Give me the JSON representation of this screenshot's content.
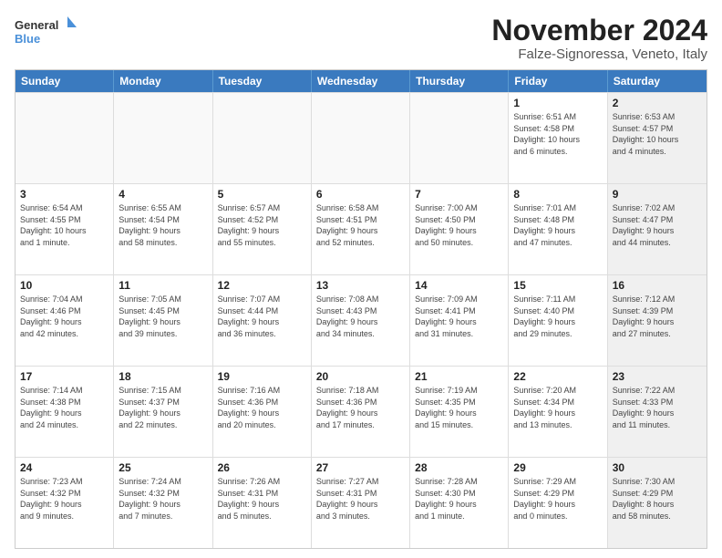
{
  "logo": {
    "line1": "General",
    "line2": "Blue"
  },
  "title": "November 2024",
  "subtitle": "Falze-Signoressa, Veneto, Italy",
  "header_days": [
    "Sunday",
    "Monday",
    "Tuesday",
    "Wednesday",
    "Thursday",
    "Friday",
    "Saturday"
  ],
  "weeks": [
    [
      {
        "day": "",
        "info": "",
        "shaded": true
      },
      {
        "day": "",
        "info": "",
        "shaded": true
      },
      {
        "day": "",
        "info": "",
        "shaded": true
      },
      {
        "day": "",
        "info": "",
        "shaded": true
      },
      {
        "day": "",
        "info": "",
        "shaded": true
      },
      {
        "day": "1",
        "info": "Sunrise: 6:51 AM\nSunset: 4:58 PM\nDaylight: 10 hours\nand 6 minutes.",
        "shaded": false
      },
      {
        "day": "2",
        "info": "Sunrise: 6:53 AM\nSunset: 4:57 PM\nDaylight: 10 hours\nand 4 minutes.",
        "shaded": true
      }
    ],
    [
      {
        "day": "3",
        "info": "Sunrise: 6:54 AM\nSunset: 4:55 PM\nDaylight: 10 hours\nand 1 minute.",
        "shaded": false
      },
      {
        "day": "4",
        "info": "Sunrise: 6:55 AM\nSunset: 4:54 PM\nDaylight: 9 hours\nand 58 minutes.",
        "shaded": false
      },
      {
        "day": "5",
        "info": "Sunrise: 6:57 AM\nSunset: 4:52 PM\nDaylight: 9 hours\nand 55 minutes.",
        "shaded": false
      },
      {
        "day": "6",
        "info": "Sunrise: 6:58 AM\nSunset: 4:51 PM\nDaylight: 9 hours\nand 52 minutes.",
        "shaded": false
      },
      {
        "day": "7",
        "info": "Sunrise: 7:00 AM\nSunset: 4:50 PM\nDaylight: 9 hours\nand 50 minutes.",
        "shaded": false
      },
      {
        "day": "8",
        "info": "Sunrise: 7:01 AM\nSunset: 4:48 PM\nDaylight: 9 hours\nand 47 minutes.",
        "shaded": false
      },
      {
        "day": "9",
        "info": "Sunrise: 7:02 AM\nSunset: 4:47 PM\nDaylight: 9 hours\nand 44 minutes.",
        "shaded": true
      }
    ],
    [
      {
        "day": "10",
        "info": "Sunrise: 7:04 AM\nSunset: 4:46 PM\nDaylight: 9 hours\nand 42 minutes.",
        "shaded": false
      },
      {
        "day": "11",
        "info": "Sunrise: 7:05 AM\nSunset: 4:45 PM\nDaylight: 9 hours\nand 39 minutes.",
        "shaded": false
      },
      {
        "day": "12",
        "info": "Sunrise: 7:07 AM\nSunset: 4:44 PM\nDaylight: 9 hours\nand 36 minutes.",
        "shaded": false
      },
      {
        "day": "13",
        "info": "Sunrise: 7:08 AM\nSunset: 4:43 PM\nDaylight: 9 hours\nand 34 minutes.",
        "shaded": false
      },
      {
        "day": "14",
        "info": "Sunrise: 7:09 AM\nSunset: 4:41 PM\nDaylight: 9 hours\nand 31 minutes.",
        "shaded": false
      },
      {
        "day": "15",
        "info": "Sunrise: 7:11 AM\nSunset: 4:40 PM\nDaylight: 9 hours\nand 29 minutes.",
        "shaded": false
      },
      {
        "day": "16",
        "info": "Sunrise: 7:12 AM\nSunset: 4:39 PM\nDaylight: 9 hours\nand 27 minutes.",
        "shaded": true
      }
    ],
    [
      {
        "day": "17",
        "info": "Sunrise: 7:14 AM\nSunset: 4:38 PM\nDaylight: 9 hours\nand 24 minutes.",
        "shaded": false
      },
      {
        "day": "18",
        "info": "Sunrise: 7:15 AM\nSunset: 4:37 PM\nDaylight: 9 hours\nand 22 minutes.",
        "shaded": false
      },
      {
        "day": "19",
        "info": "Sunrise: 7:16 AM\nSunset: 4:36 PM\nDaylight: 9 hours\nand 20 minutes.",
        "shaded": false
      },
      {
        "day": "20",
        "info": "Sunrise: 7:18 AM\nSunset: 4:36 PM\nDaylight: 9 hours\nand 17 minutes.",
        "shaded": false
      },
      {
        "day": "21",
        "info": "Sunrise: 7:19 AM\nSunset: 4:35 PM\nDaylight: 9 hours\nand 15 minutes.",
        "shaded": false
      },
      {
        "day": "22",
        "info": "Sunrise: 7:20 AM\nSunset: 4:34 PM\nDaylight: 9 hours\nand 13 minutes.",
        "shaded": false
      },
      {
        "day": "23",
        "info": "Sunrise: 7:22 AM\nSunset: 4:33 PM\nDaylight: 9 hours\nand 11 minutes.",
        "shaded": true
      }
    ],
    [
      {
        "day": "24",
        "info": "Sunrise: 7:23 AM\nSunset: 4:32 PM\nDaylight: 9 hours\nand 9 minutes.",
        "shaded": false
      },
      {
        "day": "25",
        "info": "Sunrise: 7:24 AM\nSunset: 4:32 PM\nDaylight: 9 hours\nand 7 minutes.",
        "shaded": false
      },
      {
        "day": "26",
        "info": "Sunrise: 7:26 AM\nSunset: 4:31 PM\nDaylight: 9 hours\nand 5 minutes.",
        "shaded": false
      },
      {
        "day": "27",
        "info": "Sunrise: 7:27 AM\nSunset: 4:31 PM\nDaylight: 9 hours\nand 3 minutes.",
        "shaded": false
      },
      {
        "day": "28",
        "info": "Sunrise: 7:28 AM\nSunset: 4:30 PM\nDaylight: 9 hours\nand 1 minute.",
        "shaded": false
      },
      {
        "day": "29",
        "info": "Sunrise: 7:29 AM\nSunset: 4:29 PM\nDaylight: 9 hours\nand 0 minutes.",
        "shaded": false
      },
      {
        "day": "30",
        "info": "Sunrise: 7:30 AM\nSunset: 4:29 PM\nDaylight: 8 hours\nand 58 minutes.",
        "shaded": true
      }
    ]
  ]
}
